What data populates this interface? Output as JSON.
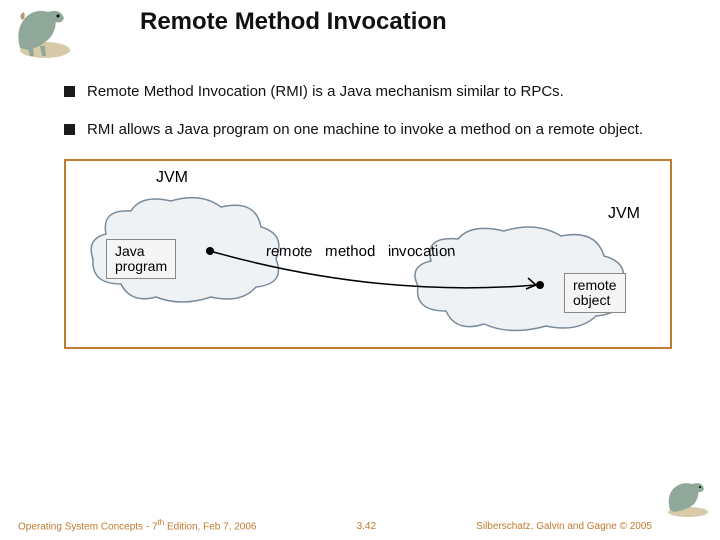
{
  "title": "Remote Method Invocation",
  "bullets": [
    "Remote Method Invocation (RMI) is a Java mechanism similar to RPCs.",
    "RMI allows a Java program on one machine to invoke a method on a remote object."
  ],
  "diagram": {
    "jvm1": "JVM",
    "jvm2": "JVM",
    "box1_line1": "Java",
    "box1_line2": "program",
    "box2_line1": "remote",
    "box2_line2": "object",
    "arc_text": "remote method invocation"
  },
  "footer": {
    "left_prefix": "Operating System Concepts - 7",
    "left_th": "th",
    "left_suffix": " Edition, Feb 7, 2006",
    "center": "3.42",
    "right": "Silberschatz, Galvin and Gagne © 2005"
  }
}
